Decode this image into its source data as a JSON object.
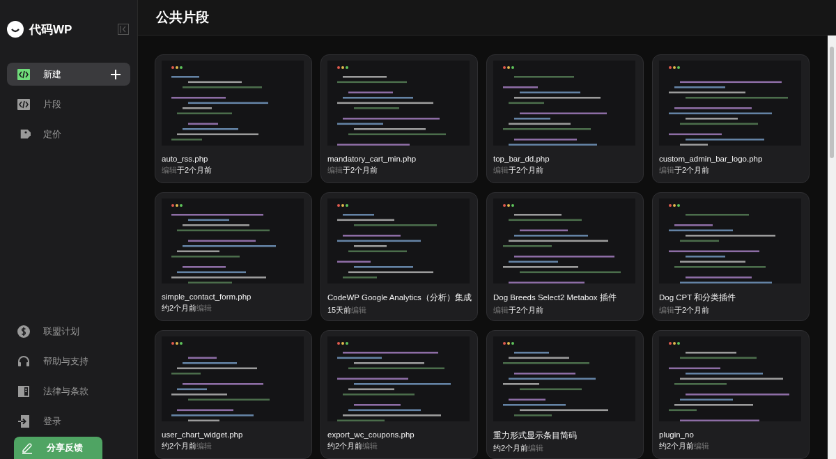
{
  "app": {
    "name": "代码WP"
  },
  "sidebar": {
    "items": [
      {
        "label": "新建",
        "kind": "new",
        "selected": true
      },
      {
        "label": "片段",
        "kind": "link",
        "selected": false
      },
      {
        "label": "定价",
        "kind": "link",
        "selected": false
      }
    ],
    "footer_items": [
      {
        "label": "联盟计划"
      },
      {
        "label": "帮助与支持"
      },
      {
        "label": "法律与条款"
      },
      {
        "label": "登录"
      }
    ],
    "feedback_button": {
      "label": "分享反馈"
    }
  },
  "main": {
    "title": "公共片段",
    "snippets": [
      {
        "name": "auto_rss.php",
        "meta": [
          {
            "text": "编辑",
            "muted": true
          },
          {
            "text": "于2个月前",
            "muted": false
          }
        ]
      },
      {
        "name": "mandatory_cart_min.php",
        "meta": [
          {
            "text": "编辑",
            "muted": true
          },
          {
            "text": "于2个月前",
            "muted": false
          }
        ]
      },
      {
        "name": "top_bar_dd.php",
        "meta": [
          {
            "text": "编辑",
            "muted": true
          },
          {
            "text": "于2个月前",
            "muted": false
          }
        ]
      },
      {
        "name": "custom_admin_bar_logo.php",
        "meta": [
          {
            "text": "编辑",
            "muted": true
          },
          {
            "text": "于2个月前",
            "muted": false
          }
        ]
      },
      {
        "name": "simple_contact_form.php",
        "meta": [
          {
            "text": "约2个月前",
            "muted": false
          },
          {
            "text": "编辑",
            "muted": true
          }
        ]
      },
      {
        "name": "CodeWP Google Analytics（分析）集成",
        "meta": [
          {
            "text": "15天前",
            "muted": false
          },
          {
            "text": "编辑",
            "muted": true
          }
        ]
      },
      {
        "name": "Dog Breeds Select2 Metabox 插件",
        "meta": [
          {
            "text": "编辑",
            "muted": true
          },
          {
            "text": "于2个月前",
            "muted": false
          }
        ]
      },
      {
        "name": "Dog CPT 和分类插件",
        "meta": [
          {
            "text": "编辑",
            "muted": true
          },
          {
            "text": "于2个月前",
            "muted": false
          }
        ]
      },
      {
        "name": "user_chart_widget.php",
        "meta": [
          {
            "text": "约2个月前",
            "muted": false
          },
          {
            "text": "编辑",
            "muted": true
          }
        ]
      },
      {
        "name": "export_wc_coupons.php",
        "meta": [
          {
            "text": "约2个月前",
            "muted": false
          },
          {
            "text": "编辑",
            "muted": true
          }
        ]
      },
      {
        "name": "重力形式显示条目简码",
        "meta": [
          {
            "text": "约2个月前",
            "muted": false
          },
          {
            "text": "编辑",
            "muted": true
          }
        ]
      },
      {
        "name": "plugin_no",
        "meta": [
          {
            "text": "约2个月前",
            "muted": false
          },
          {
            "text": "编辑",
            "muted": true
          }
        ]
      }
    ]
  }
}
